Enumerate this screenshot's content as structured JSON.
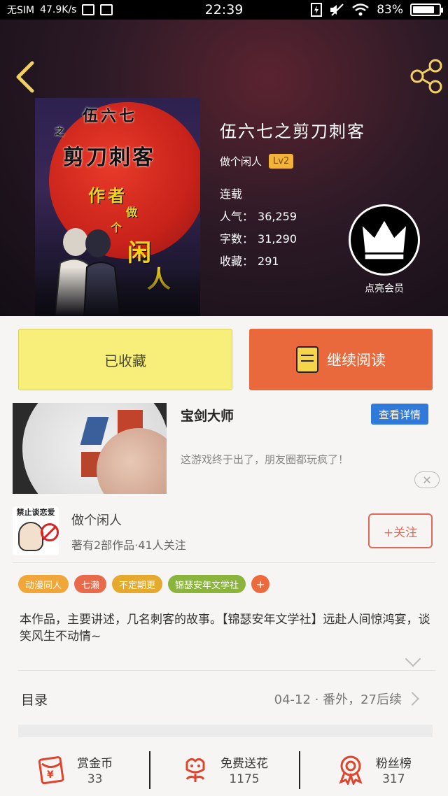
{
  "status_bar": {
    "carrier": "无SIM",
    "speed": "47.9K/s",
    "time": "22:39",
    "battery": "83%",
    "battery_level": 0.83
  },
  "book": {
    "title": "伍六七之剪刀刺客",
    "author": "做个闲人",
    "level": "Lv2",
    "status": "连载",
    "stats": [
      {
        "label": "人气：",
        "value": "36,259"
      },
      {
        "label": "字数：",
        "value": "31,290"
      },
      {
        "label": "收藏：",
        "value": "291"
      }
    ],
    "cover_text": {
      "line1": "伍六七",
      "line2": "之",
      "line3": "剪刀刺客",
      "author1": "作者",
      "author2": "做",
      "author3": "个",
      "author4": "闲",
      "author5": "人"
    }
  },
  "vip": {
    "label": "点亮会员"
  },
  "actions": {
    "favorited_label": "已收藏",
    "read_label": "继续阅读"
  },
  "ad": {
    "title": "宝剑大师",
    "detail_label": "查看详情",
    "description": "这游戏终于出了，朋友圈都玩疯了！",
    "close_symbol": "✕"
  },
  "author_card": {
    "name": "做个闲人",
    "meta": "著有2部作品·41人关注",
    "follow_label": "+关注",
    "avatar_text": "禁止谈恋爱"
  },
  "tags": [
    {
      "label": "动漫同人",
      "color": "#f1a63a"
    },
    {
      "label": "七濑",
      "color": "#e96a4a"
    },
    {
      "label": "不定期更",
      "color": "#e5a92e"
    },
    {
      "label": "锦瑟安年文学社",
      "color": "#8ab43c"
    },
    {
      "label": "+",
      "color": "#ee6a3c"
    }
  ],
  "synopsis": "本作品，主要讲述，几名刺客的故事。【锦瑟安年文学社】远赴人间惊鸿宴，谈笑风生不动情~",
  "toc": {
    "label": "目录",
    "latest": "04-12 · 番外，27后续"
  },
  "bottom_bar": [
    {
      "icon": "red-envelope-icon",
      "label": "赏金币",
      "value": "33"
    },
    {
      "icon": "flower-icon",
      "label": "免费送花",
      "value": "1175"
    },
    {
      "icon": "ribbon-medal-icon",
      "label": "粉丝榜",
      "value": "317"
    }
  ],
  "colors": {
    "accent_orange": "#e9693c",
    "fav_yellow": "#f8ee7a",
    "ad_blue": "#2f7ad8",
    "icon_red": "#e0442c"
  }
}
